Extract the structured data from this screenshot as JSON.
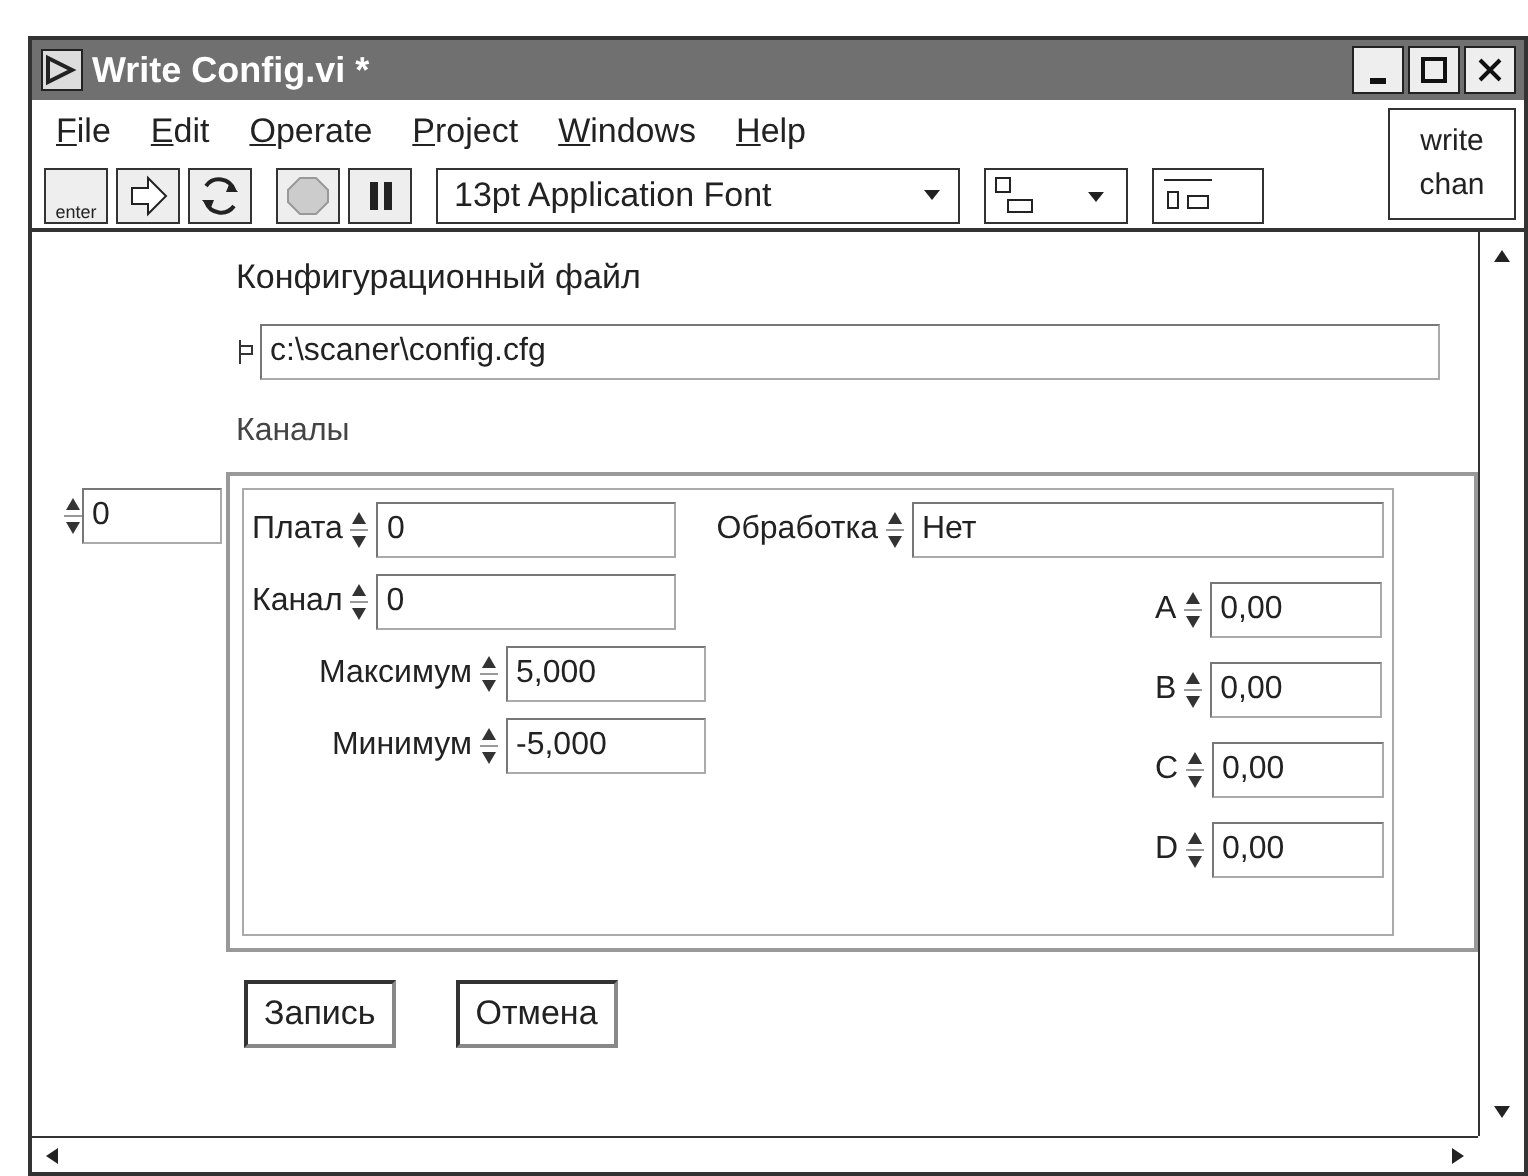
{
  "window": {
    "title": "Write Config.vi *"
  },
  "menu": [
    "File",
    "Edit",
    "Operate",
    "Project",
    "Windows",
    "Help"
  ],
  "toolbar": {
    "run_label": "enter",
    "font": "13pt Application Font"
  },
  "context_help": [
    "write",
    "chan"
  ],
  "config_file": {
    "label": "Конфигурационный файл",
    "value": "c:\\scaner\\config.cfg"
  },
  "channels": {
    "label": "Каналы",
    "index": "0",
    "left_fields": [
      {
        "label": "Плата",
        "value": "0",
        "kind": "short"
      },
      {
        "label": "Канал",
        "value": "0",
        "kind": "short"
      },
      {
        "label": "Максимум",
        "value": "5,000",
        "kind": "long"
      },
      {
        "label": "Минимум",
        "value": "-5,000",
        "kind": "long"
      }
    ],
    "processing": {
      "label": "Обработка",
      "value": "Нет"
    },
    "coefficients": [
      {
        "label": "A",
        "value": "0,00"
      },
      {
        "label": "B",
        "value": "0,00"
      },
      {
        "label": "C",
        "value": "0,00"
      },
      {
        "label": "D",
        "value": "0,00"
      }
    ]
  },
  "buttons": [
    "Запись",
    "Отмена"
  ]
}
